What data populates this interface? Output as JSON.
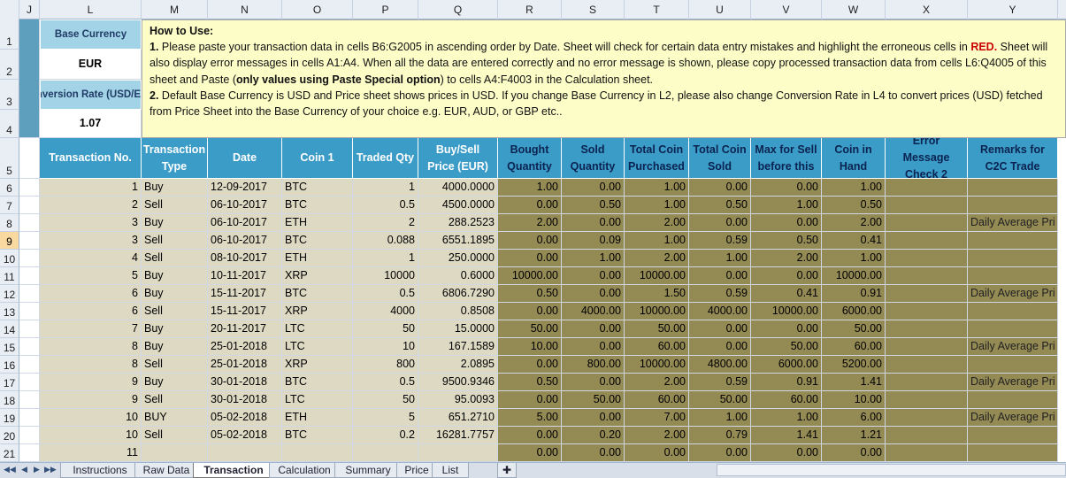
{
  "columns": [
    "J",
    "L",
    "M",
    "N",
    "O",
    "P",
    "Q",
    "R",
    "S",
    "T",
    "U",
    "V",
    "W",
    "X",
    "Y"
  ],
  "selected_column": "",
  "selected_row": "9",
  "left_panel": {
    "base_currency_label": "Base Currency",
    "base_currency_value": "EUR",
    "conversion_label": "Conversion Rate (USD/EUR)",
    "conversion_value": "1.07"
  },
  "howto": {
    "title": "How to Use:",
    "p1_num": "1.",
    "p1_a": " Please paste your transaction data in cells B6:G2005  in ascending order by Date. Sheet will check for certain data entry mistakes and highlight the erroneous cells in ",
    "p1_red": "RED.",
    "p1_b": " Sheet will also display error messages in cells A1:A4. When all the data are entered correctly and no error message is shown, please copy processed transaction data from cells L6:Q4005  of this sheet and Paste (",
    "p1_bold": "only values using Paste Special option",
    "p1_c": ") to cells A4:F4003  in the Calculation  sheet.",
    "p2_num": "2.",
    "p2_a": " Default Base Currency is USD and Price sheet shows prices in USD. If you change Base Currency in  L2, please also change Conversion Rate in L4 to convert prices (USD) fetched from Price Sheet into the Base Currency of your choice e.g. EUR, AUD, or GBP etc.."
  },
  "headers": [
    "Transaction No.",
    "Transaction Type",
    "Date",
    "Coin 1",
    "Traded Qty",
    "Buy/Sell Price (EUR)",
    "Bought Quantity",
    "Sold Quantity",
    "Total Coin Purchased",
    "Total Coin Sold",
    "Max for Sell before this",
    "Coin in Hand",
    "Error Message Check 2",
    "Remarks for C2C Trade"
  ],
  "rows": [
    {
      "n": "6",
      "c": [
        "1",
        "Buy",
        "12-09-2017",
        "BTC",
        "1",
        "4000.0000",
        "1.00",
        "0.00",
        "1.00",
        "0.00",
        "0.00",
        "1.00",
        "",
        ""
      ]
    },
    {
      "n": "7",
      "c": [
        "2",
        "Sell",
        "06-10-2017",
        "BTC",
        "0.5",
        "4500.0000",
        "0.00",
        "0.50",
        "1.00",
        "0.50",
        "1.00",
        "0.50",
        "",
        ""
      ]
    },
    {
      "n": "8",
      "c": [
        "3",
        "Buy",
        "06-10-2017",
        "ETH",
        "2",
        "288.2523",
        "2.00",
        "0.00",
        "2.00",
        "0.00",
        "0.00",
        "2.00",
        "",
        "Daily Average Pri"
      ]
    },
    {
      "n": "9",
      "c": [
        "3",
        "Sell",
        "06-10-2017",
        "BTC",
        "0.088",
        "6551.1895",
        "0.00",
        "0.09",
        "1.00",
        "0.59",
        "0.50",
        "0.41",
        "",
        ""
      ]
    },
    {
      "n": "10",
      "c": [
        "4",
        "Sell",
        "08-10-2017",
        "ETH",
        "1",
        "250.0000",
        "0.00",
        "1.00",
        "2.00",
        "1.00",
        "2.00",
        "1.00",
        "",
        ""
      ]
    },
    {
      "n": "11",
      "c": [
        "5",
        "Buy",
        "10-11-2017",
        "XRP",
        "10000",
        "0.6000",
        "10000.00",
        "0.00",
        "10000.00",
        "0.00",
        "0.00",
        "10000.00",
        "",
        ""
      ]
    },
    {
      "n": "12",
      "c": [
        "6",
        "Buy",
        "15-11-2017",
        "BTC",
        "0.5",
        "6806.7290",
        "0.50",
        "0.00",
        "1.50",
        "0.59",
        "0.41",
        "0.91",
        "",
        "Daily Average Pri"
      ]
    },
    {
      "n": "13",
      "c": [
        "6",
        "Sell",
        "15-11-2017",
        "XRP",
        "4000",
        "0.8508",
        "0.00",
        "4000.00",
        "10000.00",
        "4000.00",
        "10000.00",
        "6000.00",
        "",
        ""
      ]
    },
    {
      "n": "14",
      "c": [
        "7",
        "Buy",
        "20-11-2017",
        "LTC",
        "50",
        "15.0000",
        "50.00",
        "0.00",
        "50.00",
        "0.00",
        "0.00",
        "50.00",
        "",
        ""
      ]
    },
    {
      "n": "15",
      "c": [
        "8",
        "Buy",
        "25-01-2018",
        "LTC",
        "10",
        "167.1589",
        "10.00",
        "0.00",
        "60.00",
        "0.00",
        "50.00",
        "60.00",
        "",
        "Daily Average Pri"
      ]
    },
    {
      "n": "16",
      "c": [
        "8",
        "Sell",
        "25-01-2018",
        "XRP",
        "800",
        "2.0895",
        "0.00",
        "800.00",
        "10000.00",
        "4800.00",
        "6000.00",
        "5200.00",
        "",
        ""
      ]
    },
    {
      "n": "17",
      "c": [
        "9",
        "Buy",
        "30-01-2018",
        "BTC",
        "0.5",
        "9500.9346",
        "0.50",
        "0.00",
        "2.00",
        "0.59",
        "0.91",
        "1.41",
        "",
        "Daily Average Pri"
      ]
    },
    {
      "n": "18",
      "c": [
        "9",
        "Sell",
        "30-01-2018",
        "LTC",
        "50",
        "95.0093",
        "0.00",
        "50.00",
        "60.00",
        "50.00",
        "60.00",
        "10.00",
        "",
        ""
      ]
    },
    {
      "n": "19",
      "c": [
        "10",
        "BUY",
        "05-02-2018",
        "ETH",
        "5",
        "651.2710",
        "5.00",
        "0.00",
        "7.00",
        "1.00",
        "1.00",
        "6.00",
        "",
        "Daily Average Pri"
      ]
    },
    {
      "n": "20",
      "c": [
        "10",
        "Sell",
        "05-02-2018",
        "BTC",
        "0.2",
        "16281.7757",
        "0.00",
        "0.20",
        "2.00",
        "0.79",
        "1.41",
        "1.21",
        "",
        ""
      ]
    },
    {
      "n": "21",
      "c": [
        "11",
        "",
        "",
        "",
        "",
        "",
        "0.00",
        "0.00",
        "0.00",
        "0.00",
        "0.00",
        "0.00",
        "",
        ""
      ]
    }
  ],
  "top_rows": [
    "1",
    "2",
    "3",
    "4",
    "5"
  ],
  "tabs": [
    "Instructions",
    "Raw Data",
    "Transaction",
    "Calculation",
    "Summary",
    "Price",
    "List"
  ],
  "active_tab": "Transaction",
  "colors": {
    "header_blue": "#3c9cc8",
    "tan": "#ddd9c3",
    "olive": "#948a54",
    "howto_bg": "#fdfdc8"
  }
}
